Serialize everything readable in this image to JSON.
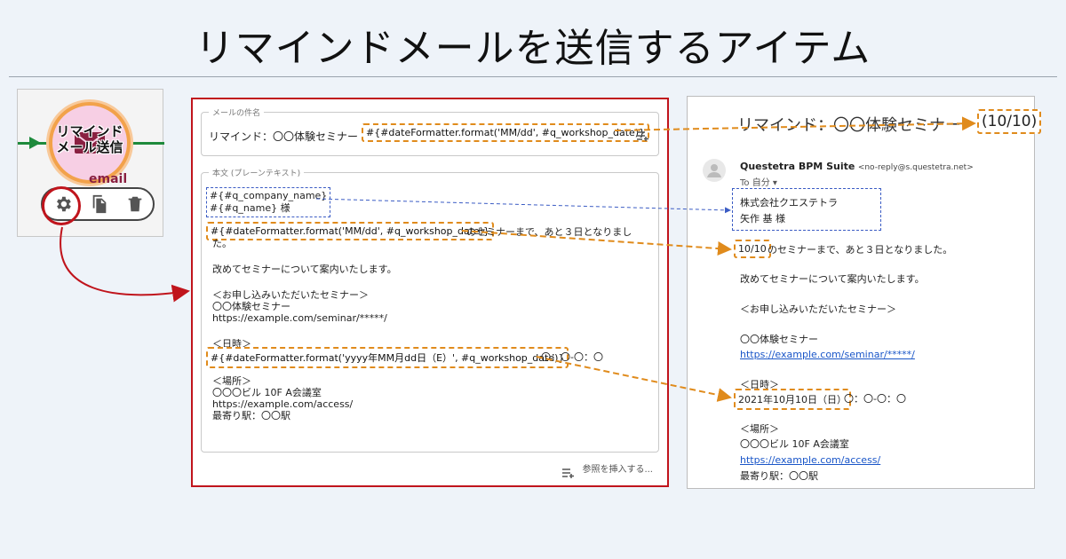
{
  "title": "リマインドメールを送信するアイテム",
  "node": {
    "label_line1": "リマインド",
    "label_line2": "メール送信",
    "type": "email",
    "actions": [
      "gear-icon",
      "copy-icon",
      "trash-icon"
    ]
  },
  "form": {
    "subject_legend": "メールの件名",
    "subject_prefix": "リマインド：〇〇体験セミナー",
    "subject_expression": "#{#dateFormatter.format('MM/dd', #q_workshop_date)}",
    "body_legend": "本文 (プレーンテキスト)",
    "company_expr": "#{#q_company_name}",
    "name_expr": "#{#q_name} 様",
    "date_expr": "#{#dateFormatter.format('MM/dd', #q_workshop_date)}",
    "date_expr_suffix": "のセミナーまで、あと３日となりまし",
    "date_expr_suffix2": "た。",
    "intro": "改めてセミナーについて案内いたします。",
    "seminar_header": "＜お申し込みいただいたセミナー＞",
    "seminar_name": "〇〇体験セミナー",
    "seminar_url": "https://example.com/seminar/*****/",
    "datetime_header": "＜日時＞",
    "datetime_expr": "#{#dateFormatter.format('yyyy年MM月dd日（E）', #q_workshop_date)}",
    "datetime_suffix": "〇：〇-〇：〇",
    "place_header": "＜場所＞",
    "place_name": "〇〇〇ビル 10F A会議室",
    "place_url": "https://example.com/access/",
    "station": "最寄り駅：〇〇駅",
    "insert_ref": "参照を挿入する..."
  },
  "email": {
    "subject": "リマインド：〇〇体験セミナー",
    "subject_date": "(10/10)",
    "sender_name": "Questetra BPM Suite",
    "sender_addr": "<no-reply@s.questetra.net>",
    "to": "To 自分 ▾",
    "company": "株式会社クエステトラ",
    "name": "矢作 基 様",
    "date": "10/10",
    "date_suffix": "のセミナーまで、あと３日となりました。",
    "intro": "改めてセミナーについて案内いたします。",
    "seminar_header": "＜お申し込みいただいたセミナー＞",
    "seminar_name": "〇〇体験セミナー",
    "seminar_url": "https://example.com/seminar/*****/",
    "datetime_header": "＜日時＞",
    "datetime": "2021年10月10日（日）",
    "datetime_suffix": "〇：〇-〇：〇",
    "place_header": "＜場所＞",
    "place_name": "〇〇〇ビル 10F A会議室",
    "place_url": "https://example.com/access/",
    "station": "最寄り駅：〇〇駅"
  },
  "colors": {
    "highlight_red": "#c0141c",
    "dash_orange": "#e08b1c",
    "dash_blue": "#3b5cc4",
    "flow_green": "#1e8a3c",
    "node_type": "#8a2041"
  }
}
